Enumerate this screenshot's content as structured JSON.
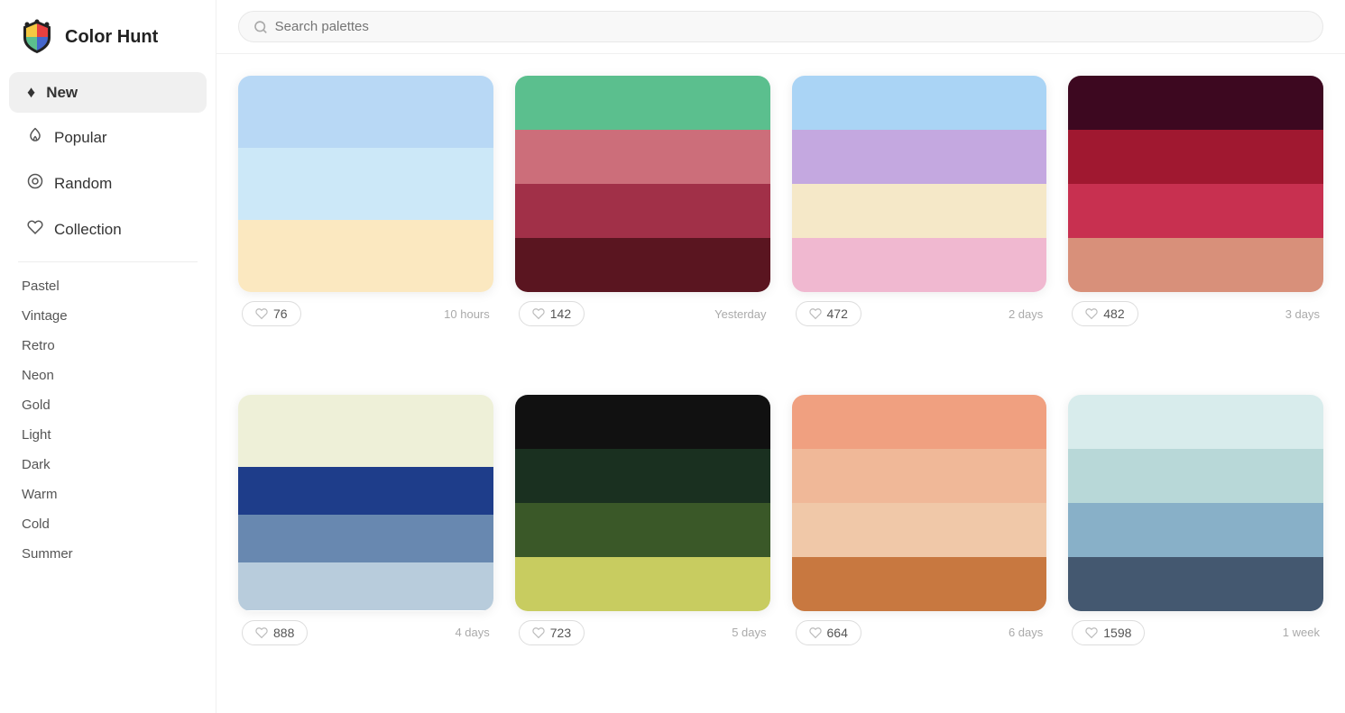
{
  "logo": {
    "text": "Color Hunt"
  },
  "search": {
    "placeholder": "Search palettes"
  },
  "nav": {
    "items": [
      {
        "id": "new",
        "label": "New",
        "icon": "♦",
        "active": true
      },
      {
        "id": "popular",
        "label": "Popular",
        "icon": "🔥"
      },
      {
        "id": "random",
        "label": "Random",
        "icon": "◎"
      },
      {
        "id": "collection",
        "label": "Collection",
        "icon": "♡"
      }
    ]
  },
  "tags": [
    "Pastel",
    "Vintage",
    "Retro",
    "Neon",
    "Gold",
    "Light",
    "Dark",
    "Warm",
    "Cold",
    "Summer"
  ],
  "palettes": [
    {
      "id": 1,
      "colors": [
        "#b8d8f5",
        "#cce8f8",
        "#fad8a0",
        "#fad8a0"
      ],
      "swatches": [
        "#b8d8f5",
        "#cce8f8",
        "#fbe8c0"
      ],
      "likes": 76,
      "time": "10 hours"
    },
    {
      "id": 2,
      "colors": [
        "#5bbf8e",
        "#cc6e7a",
        "#a13048",
        "#5a1520"
      ],
      "swatches": [
        "#5bbf8e",
        "#cc6e7a",
        "#a13048",
        "#5a1520"
      ],
      "likes": 142,
      "time": "Yesterday"
    },
    {
      "id": 3,
      "colors": [
        "#aad4f5",
        "#c4a8e0",
        "#f5e8c8",
        "#f0b8d0"
      ],
      "swatches": [
        "#aad4f5",
        "#c4a8e0",
        "#f5e8c8",
        "#f0b8d0"
      ],
      "likes": 472,
      "time": "2 days"
    },
    {
      "id": 4,
      "colors": [
        "#3d0820",
        "#a01830",
        "#c83050",
        "#d8907a"
      ],
      "swatches": [
        "#3d0820",
        "#a01830",
        "#c83050",
        "#d8907a"
      ],
      "likes": 482,
      "time": "3 days"
    },
    {
      "id": 5,
      "colors": [
        "#eef0d8",
        "#eef0d8",
        "#1e3d8a",
        "#6888b0",
        "#b8ccdc"
      ],
      "swatches": [
        "#eef0d8",
        "#1e3d8a",
        "#6888b0",
        "#b8ccdc"
      ],
      "likes": 888,
      "time": "4 days"
    },
    {
      "id": 6,
      "colors": [
        "#111111",
        "#1a3020",
        "#3a5828",
        "#c8cc60"
      ],
      "swatches": [
        "#111111",
        "#1a3020",
        "#3a5828",
        "#c8cc60"
      ],
      "likes": 723,
      "time": "5 days"
    },
    {
      "id": 7,
      "colors": [
        "#f0a080",
        "#f0b898",
        "#f0c8a8",
        "#c87840"
      ],
      "swatches": [
        "#f0a080",
        "#f0b898",
        "#f0c8a8",
        "#c87840"
      ],
      "likes": 664,
      "time": "6 days"
    },
    {
      "id": 8,
      "colors": [
        "#d8ecec",
        "#b8d8d8",
        "#88b0c8",
        "#445870"
      ],
      "swatches": [
        "#d8ecec",
        "#b8d8d8",
        "#88b0c8",
        "#445870"
      ],
      "likes": 1598,
      "time": "1 week"
    }
  ],
  "palette_colors": {
    "p1": [
      "#b8d8f5",
      "#cde8f8",
      "#fbe8c0"
    ],
    "p2": [
      "#5bbf8e",
      "#cc6e7a",
      "#a13048",
      "#5a1520"
    ],
    "p3": [
      "#aad4f5",
      "#c4a8e0",
      "#f5e8c8",
      "#f0b8d0"
    ],
    "p4": [
      "#3d0820",
      "#a01830",
      "#c83050",
      "#d8907a"
    ],
    "p5": [
      "#eef0d8",
      "#1e3d8a",
      "#6888b0",
      "#b8ccdc"
    ],
    "p6": [
      "#111111",
      "#1a3020",
      "#3a5828",
      "#c8cc60"
    ],
    "p7": [
      "#f0a080",
      "#f0b898",
      "#f0c8a8",
      "#c87840"
    ],
    "p8": [
      "#d8ecec",
      "#b8d8d8",
      "#88b0c8",
      "#445870"
    ]
  }
}
